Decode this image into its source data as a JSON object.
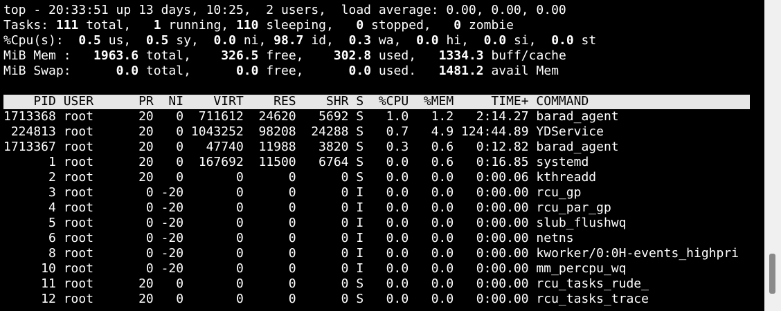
{
  "summary": {
    "top_line": "top - 20:33:51 up 13 days, 10:25,  2 users,  load average: 0.00, 0.00, 0.00",
    "tasks": {
      "label": "Tasks: ",
      "total": "111",
      "total_label": " total,   ",
      "running": "1",
      "running_label": " running, ",
      "sleeping": "110",
      "sleeping_label": " sleeping,   ",
      "stopped": "0",
      "stopped_label": " stopped,   ",
      "zombie": "0",
      "zombie_label": " zombie"
    },
    "cpu": {
      "label": "%Cpu(s):  ",
      "us": "0.5",
      "us_label": " us,  ",
      "sy": "0.5",
      "sy_label": " sy,  ",
      "ni": "0.0",
      "ni_label": " ni, ",
      "id": "98.7",
      "id_label": " id,  ",
      "wa": "0.3",
      "wa_label": " wa,  ",
      "hi": "0.0",
      "hi_label": " hi,  ",
      "si": "0.0",
      "si_label": " si,  ",
      "st": "0.0",
      "st_label": " st"
    },
    "mem": {
      "label": "MiB Mem :   ",
      "total": "1963.6",
      "total_label": " total,    ",
      "free": "326.5",
      "free_label": " free,    ",
      "used": "302.8",
      "used_label": " used,   ",
      "buff_cache": "1334.3",
      "buff_cache_label": " buff/cache"
    },
    "swap": {
      "label": "MiB Swap:      ",
      "total": "0.0",
      "total_label": " total,      ",
      "free": "0.0",
      "free_label": " free,      ",
      "used": "0.0",
      "used_label": " used.   ",
      "avail": "1481.2",
      "avail_label": " avail Mem"
    }
  },
  "process_table": {
    "header": "    PID USER      PR  NI    VIRT    RES    SHR S  %CPU  %MEM     TIME+ COMMAND",
    "columns": [
      "PID",
      "USER",
      "PR",
      "NI",
      "VIRT",
      "RES",
      "SHR",
      "S",
      "%CPU",
      "%MEM",
      "TIME+",
      "COMMAND"
    ],
    "rows": [
      {
        "pid": "1713368",
        "user": "root",
        "pr": "20",
        "ni": "0",
        "virt": "711612",
        "res": "24620",
        "shr": "5692",
        "s": "S",
        "cpu": "1.0",
        "mem": "1.2",
        "time": "2:14.27",
        "command": "barad_agent"
      },
      {
        "pid": "224813",
        "user": "root",
        "pr": "20",
        "ni": "0",
        "virt": "1043252",
        "res": "98208",
        "shr": "24288",
        "s": "S",
        "cpu": "0.7",
        "mem": "4.9",
        "time": "124:44.89",
        "command": "YDService"
      },
      {
        "pid": "1713367",
        "user": "root",
        "pr": "20",
        "ni": "0",
        "virt": "47740",
        "res": "11988",
        "shr": "3820",
        "s": "S",
        "cpu": "0.3",
        "mem": "0.6",
        "time": "0:12.82",
        "command": "barad_agent"
      },
      {
        "pid": "1",
        "user": "root",
        "pr": "20",
        "ni": "0",
        "virt": "167692",
        "res": "11500",
        "shr": "6764",
        "s": "S",
        "cpu": "0.0",
        "mem": "0.6",
        "time": "0:16.85",
        "command": "systemd"
      },
      {
        "pid": "2",
        "user": "root",
        "pr": "20",
        "ni": "0",
        "virt": "0",
        "res": "0",
        "shr": "0",
        "s": "S",
        "cpu": "0.0",
        "mem": "0.0",
        "time": "0:00.06",
        "command": "kthreadd"
      },
      {
        "pid": "3",
        "user": "root",
        "pr": "0",
        "ni": "-20",
        "virt": "0",
        "res": "0",
        "shr": "0",
        "s": "I",
        "cpu": "0.0",
        "mem": "0.0",
        "time": "0:00.00",
        "command": "rcu_gp"
      },
      {
        "pid": "4",
        "user": "root",
        "pr": "0",
        "ni": "-20",
        "virt": "0",
        "res": "0",
        "shr": "0",
        "s": "I",
        "cpu": "0.0",
        "mem": "0.0",
        "time": "0:00.00",
        "command": "rcu_par_gp"
      },
      {
        "pid": "5",
        "user": "root",
        "pr": "0",
        "ni": "-20",
        "virt": "0",
        "res": "0",
        "shr": "0",
        "s": "I",
        "cpu": "0.0",
        "mem": "0.0",
        "time": "0:00.00",
        "command": "slub_flushwq"
      },
      {
        "pid": "6",
        "user": "root",
        "pr": "0",
        "ni": "-20",
        "virt": "0",
        "res": "0",
        "shr": "0",
        "s": "I",
        "cpu": "0.0",
        "mem": "0.0",
        "time": "0:00.00",
        "command": "netns"
      },
      {
        "pid": "8",
        "user": "root",
        "pr": "0",
        "ni": "-20",
        "virt": "0",
        "res": "0",
        "shr": "0",
        "s": "I",
        "cpu": "0.0",
        "mem": "0.0",
        "time": "0:00.00",
        "command": "kworker/0:0H-events_highpri"
      },
      {
        "pid": "10",
        "user": "root",
        "pr": "0",
        "ni": "-20",
        "virt": "0",
        "res": "0",
        "shr": "0",
        "s": "I",
        "cpu": "0.0",
        "mem": "0.0",
        "time": "0:00.00",
        "command": "mm_percpu_wq"
      },
      {
        "pid": "11",
        "user": "root",
        "pr": "20",
        "ni": "0",
        "virt": "0",
        "res": "0",
        "shr": "0",
        "s": "S",
        "cpu": "0.0",
        "mem": "0.0",
        "time": "0:00.00",
        "command": "rcu_tasks_rude_"
      },
      {
        "pid": "12",
        "user": "root",
        "pr": "20",
        "ni": "0",
        "virt": "0",
        "res": "0",
        "shr": "0",
        "s": "S",
        "cpu": "0.0",
        "mem": "0.0",
        "time": "0:00.00",
        "command": "rcu_tasks_trace"
      }
    ]
  },
  "colors": {
    "background": "#000000",
    "foreground": "#ffffff",
    "header_bar": "#e6e6e6",
    "header_text": "#000000",
    "scrollbar_track": "#f0f0f0",
    "scrollbar_thumb": "#8a8a8a"
  }
}
